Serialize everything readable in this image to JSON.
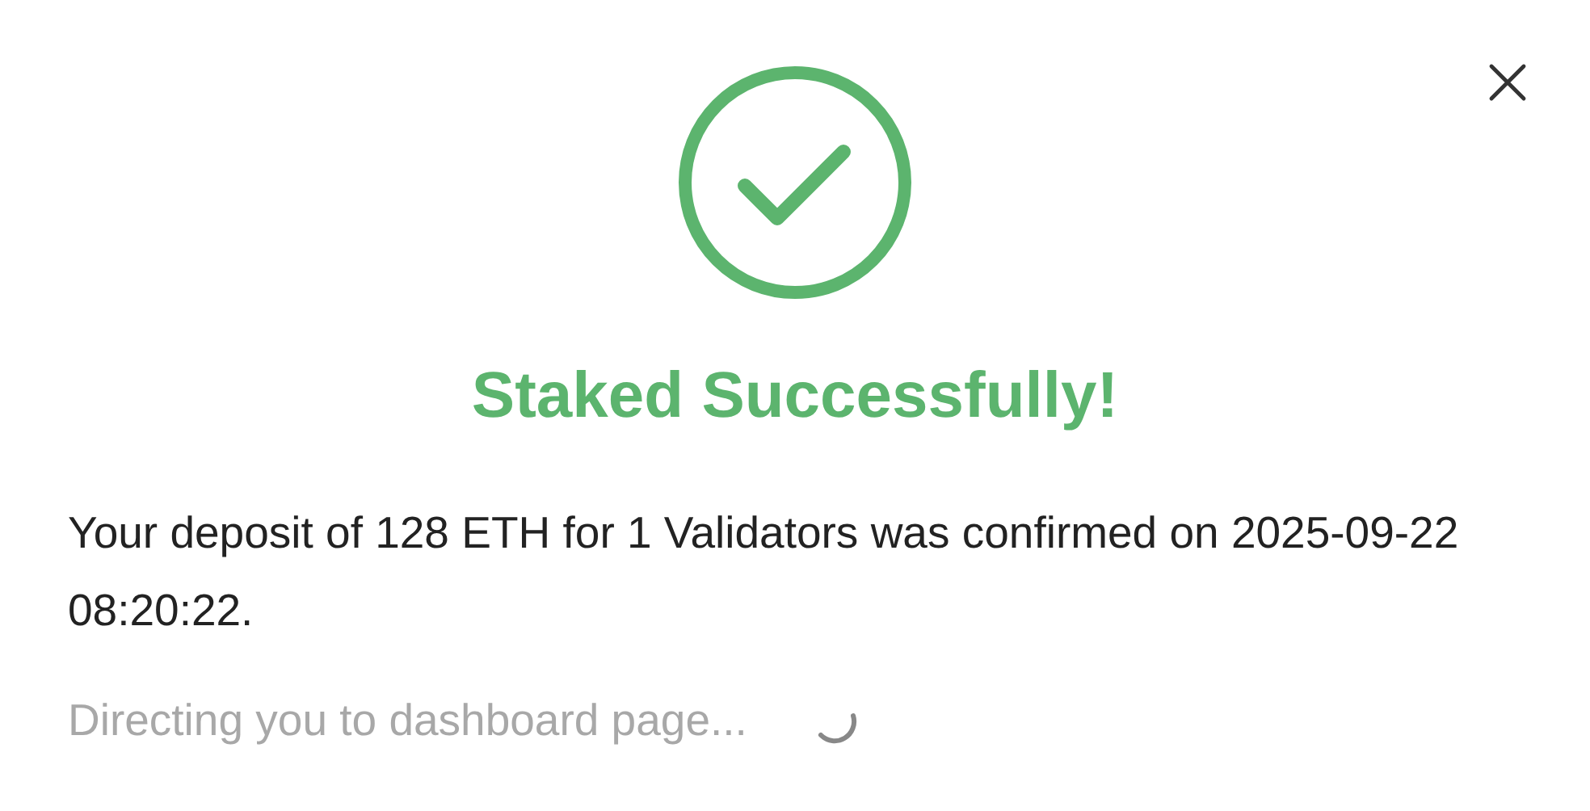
{
  "title": "Staked Successfully!",
  "message": "Your deposit of 128 ETH for 1 Validators was confirmed on 2025-09-22 08:20:22.",
  "redirect": "Directing you to dashboard page..."
}
